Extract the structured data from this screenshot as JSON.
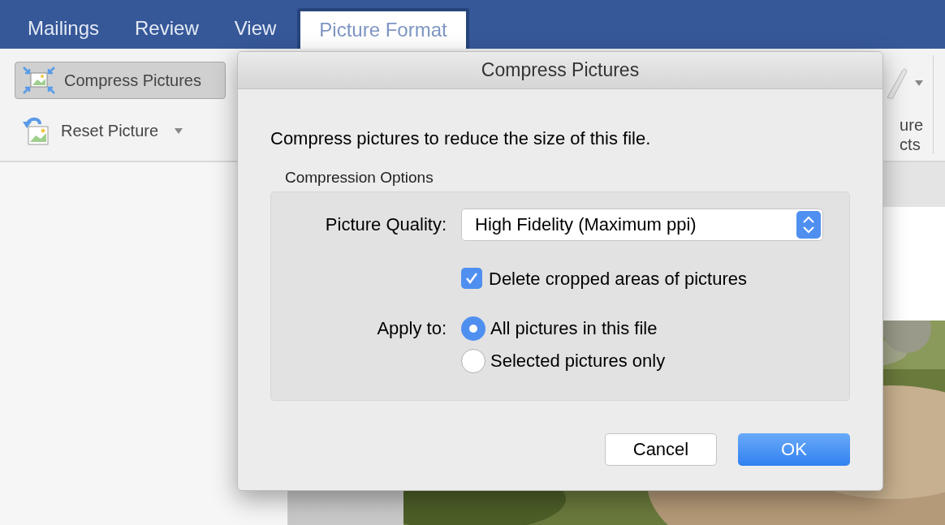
{
  "tabs": [
    {
      "label": "Mailings",
      "selected": false
    },
    {
      "label": "Review",
      "selected": false
    },
    {
      "label": "View",
      "selected": false
    },
    {
      "label": "Picture Format",
      "selected": true
    }
  ],
  "ribbon": {
    "buttons": [
      {
        "label": "Compress Pictures",
        "kind": "compress",
        "selected": true,
        "caret": false
      },
      {
        "label": "Reset Picture",
        "kind": "reset",
        "selected": false,
        "caret": true
      }
    ],
    "cut_label": [
      "ure",
      "cts"
    ]
  },
  "dialog": {
    "title": "Compress Pictures",
    "intro": "Compress pictures to reduce the size of this file.",
    "group_label": "Compression Options",
    "quality_label": "Picture Quality:",
    "quality_value": "High Fidelity (Maximum ppi)",
    "delete_cropped": {
      "label": "Delete cropped areas of pictures",
      "checked": true
    },
    "apply_label": "Apply to:",
    "apply_options": [
      {
        "label": "All pictures in this file",
        "selected": true
      },
      {
        "label": "Selected pictures only",
        "selected": false
      }
    ],
    "buttons": [
      {
        "label": "Cancel",
        "kind": "secondary"
      },
      {
        "label": "OK",
        "kind": "primary"
      }
    ]
  }
}
